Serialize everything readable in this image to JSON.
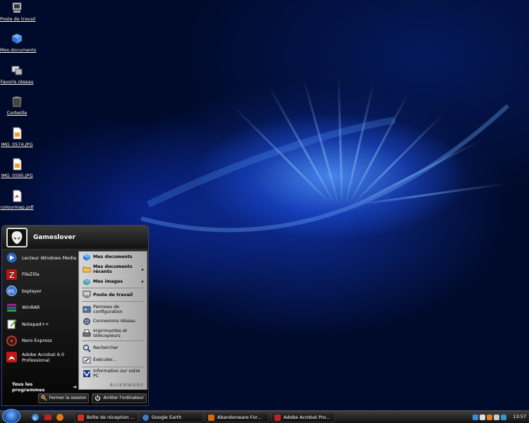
{
  "desktop": {
    "icons": [
      {
        "label": "Poste de travail",
        "icon": "computer-icon"
      },
      {
        "label": "Mes documents",
        "icon": "documents-icon"
      },
      {
        "label": "Favoris réseau",
        "icon": "network-icon"
      },
      {
        "label": "Corbeille",
        "icon": "recycle-bin-icon"
      },
      {
        "label": "IMG_0574.JPG",
        "icon": "image-file-icon"
      },
      {
        "label": "IMG_0595.JPG",
        "icon": "image-file-icon"
      },
      {
        "label": "colourmap.pdf",
        "icon": "pdf-file-icon"
      }
    ]
  },
  "start_menu": {
    "user": "Gameslover",
    "programs": [
      {
        "label": "Lecteur Windows Media",
        "icon": "media-player-icon"
      },
      {
        "label": "FileZilla",
        "icon": "filezilla-icon"
      },
      {
        "label": "bsplayer",
        "icon": "bsplayer-icon"
      },
      {
        "label": "WinRAR",
        "icon": "winrar-icon"
      },
      {
        "label": "Notepad++",
        "icon": "notepad-icon"
      },
      {
        "label": "Nero Express",
        "icon": "nero-icon"
      },
      {
        "label": "Adobe Acrobat 6.0 Professional",
        "icon": "acrobat-icon"
      }
    ],
    "all_programs": "Tous les programmes",
    "right": {
      "mes_documents": "Mes documents",
      "documents_recents": "Mes documents récents",
      "mes_images": "Mes images",
      "poste_de_travail": "Poste de travail",
      "panneau": "Panneau de configuration",
      "connexions": "Connexions réseau",
      "imprimantes": "Imprimantes et télécopieurs",
      "rechercher": "Rechercher",
      "executer": "Exécuter...",
      "information": "Information sur votre PC",
      "brand": "ALIENWARE"
    },
    "logoff": "Fermer la session",
    "shutdown": "Arrêter l'ordinateur"
  },
  "taskbar": {
    "tasks": [
      {
        "label": "Boîte de réception ...",
        "icon": "mail-icon",
        "color": "#d03020"
      },
      {
        "label": "Google Earth",
        "icon": "google-earth-icon",
        "color": "#3a7ad0"
      },
      {
        "label": "Abandonware For...",
        "icon": "browser-icon",
        "color": "#d06a10"
      },
      {
        "label": "Adobe Acrobat Pro...",
        "icon": "acrobat-icon",
        "color": "#c02030"
      }
    ],
    "clock": "13:57"
  }
}
